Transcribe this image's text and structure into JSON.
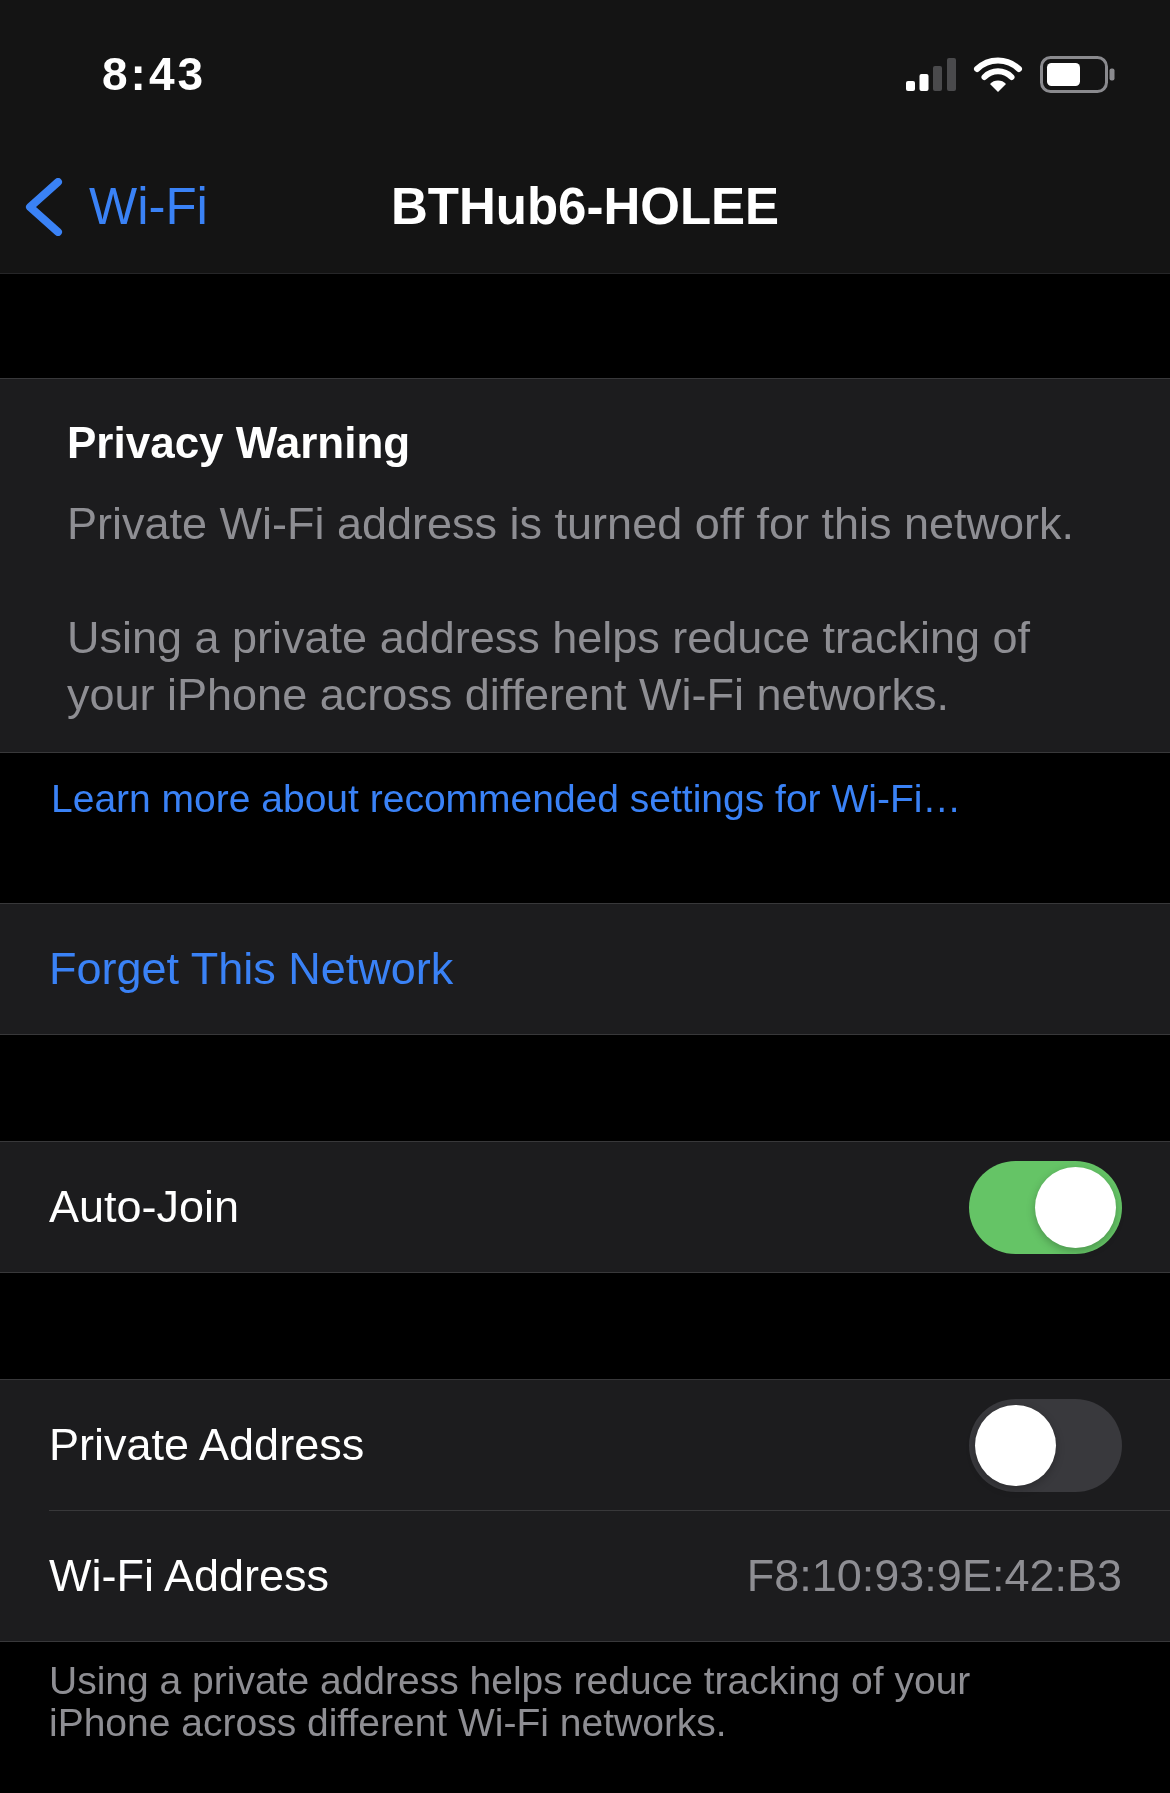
{
  "status_bar": {
    "time": "8:43"
  },
  "nav_bar": {
    "back_label": "Wi-Fi",
    "title": "BTHub6-HOLEE"
  },
  "privacy_warning": {
    "title": "Privacy Warning",
    "paragraphs": [
      "Private Wi-Fi address is turned off for this network.",
      "Using a private address helps reduce tracking of your iPhone across different Wi-Fi networks."
    ]
  },
  "learn_more_link": "Learn more about recommended settings for Wi-Fi…",
  "groups": [
    {
      "rows": [
        {
          "kind": "action",
          "label": "Forget This Network"
        }
      ]
    },
    {
      "rows": [
        {
          "kind": "toggle",
          "label": "Auto-Join",
          "on": true
        }
      ]
    },
    {
      "rows": [
        {
          "kind": "toggle",
          "label": "Private Address",
          "on": false
        },
        {
          "kind": "value",
          "label": "Wi-Fi Address",
          "value": "F8:10:93:9E:42:B3"
        }
      ],
      "footer": "Using a private address helps reduce tracking of your iPhone across different Wi-Fi networks."
    }
  ]
}
